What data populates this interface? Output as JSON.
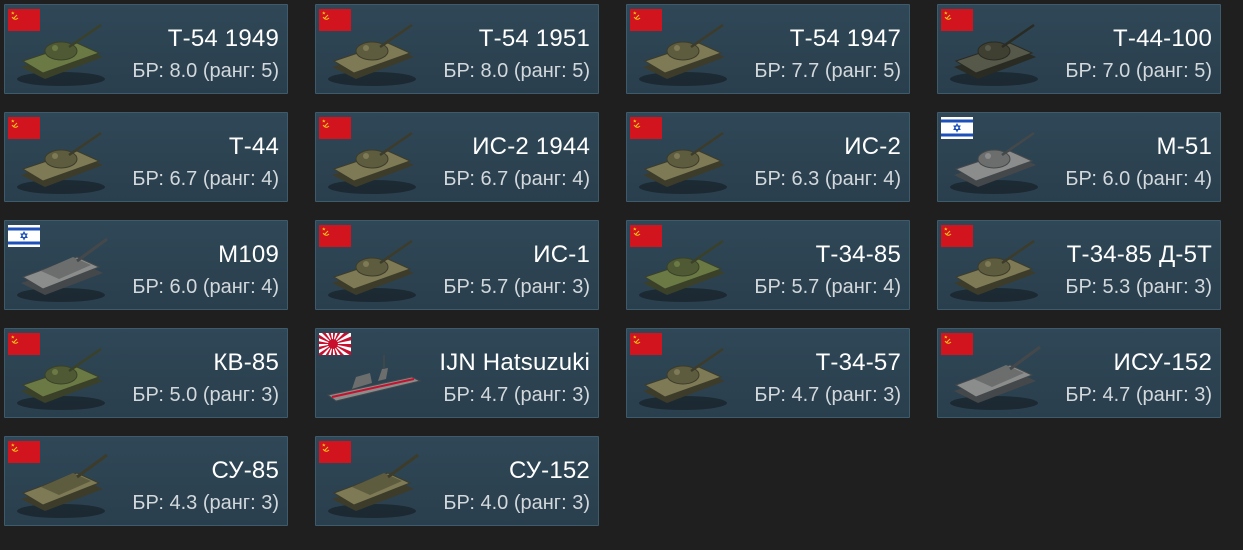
{
  "vehicles": [
    {
      "name": "Т-54 1949",
      "br": "БР: 8.0 (ранг: 5)",
      "flag": "ussr-flag",
      "vehicle_type": "tank",
      "camo": "green"
    },
    {
      "name": "Т-54 1951",
      "br": "БР: 8.0 (ранг: 5)",
      "flag": "ussr-flag",
      "vehicle_type": "tank",
      "camo": "olive"
    },
    {
      "name": "Т-54 1947",
      "br": "БР: 7.7 (ранг: 5)",
      "flag": "ussr-flag",
      "vehicle_type": "tank",
      "camo": "olive"
    },
    {
      "name": "Т-44-100",
      "br": "БР: 7.0 (ранг: 5)",
      "flag": "ussr-flag",
      "vehicle_type": "tank",
      "camo": "dark"
    },
    {
      "name": "Т-44",
      "br": "БР: 6.7 (ранг: 4)",
      "flag": "ussr-flag",
      "vehicle_type": "tank",
      "camo": "olive"
    },
    {
      "name": "ИС-2 1944",
      "br": "БР: 6.7 (ранг: 4)",
      "flag": "ussr-flag",
      "vehicle_type": "tank",
      "camo": "olive"
    },
    {
      "name": "ИС-2",
      "br": "БР: 6.3 (ранг: 4)",
      "flag": "ussr-flag",
      "vehicle_type": "tank",
      "camo": "olive"
    },
    {
      "name": "M-51",
      "br": "БР: 6.0 (ранг: 4)",
      "flag": "israel-flag",
      "vehicle_type": "tank",
      "camo": "grey"
    },
    {
      "name": "M109",
      "br": "БР: 6.0 (ранг: 4)",
      "flag": "israel-flag",
      "vehicle_type": "spg",
      "camo": "grey"
    },
    {
      "name": "ИС-1",
      "br": "БР: 5.7 (ранг: 3)",
      "flag": "ussr-flag",
      "vehicle_type": "tank",
      "camo": "olive"
    },
    {
      "name": "Т-34-85",
      "br": "БР: 5.7 (ранг: 4)",
      "flag": "ussr-flag",
      "vehicle_type": "tank",
      "camo": "green"
    },
    {
      "name": "Т-34-85 Д-5Т",
      "br": "БР: 5.3 (ранг: 3)",
      "flag": "ussr-flag",
      "vehicle_type": "tank",
      "camo": "olive"
    },
    {
      "name": "КВ-85",
      "br": "БР: 5.0 (ранг: 3)",
      "flag": "ussr-flag",
      "vehicle_type": "tank",
      "camo": "green"
    },
    {
      "name": "IJN Hatsuzuki",
      "br": "БР: 4.7 (ранг: 3)",
      "flag": "japan-flag",
      "vehicle_type": "ship",
      "camo": "grey"
    },
    {
      "name": "Т-34-57",
      "br": "БР: 4.7 (ранг: 3)",
      "flag": "ussr-flag",
      "vehicle_type": "tank",
      "camo": "olive"
    },
    {
      "name": "ИСУ-152",
      "br": "БР: 4.7 (ранг: 3)",
      "flag": "ussr-flag",
      "vehicle_type": "spg",
      "camo": "grey"
    },
    {
      "name": "СУ-85",
      "br": "БР: 4.3 (ранг: 3)",
      "flag": "ussr-flag",
      "vehicle_type": "spg",
      "camo": "olive"
    },
    {
      "name": "СУ-152",
      "br": "БР: 4.0 (ранг: 3)",
      "flag": "ussr-flag",
      "vehicle_type": "spg",
      "camo": "olive"
    }
  ],
  "colors": {
    "page_bg": "#1f1f1f",
    "card_bg": "#2f4757",
    "card_border": "#3e5b6c",
    "ussr_red": "#d2141e",
    "israel_blue": "#1d50b8",
    "japan_red": "#c8102e"
  }
}
